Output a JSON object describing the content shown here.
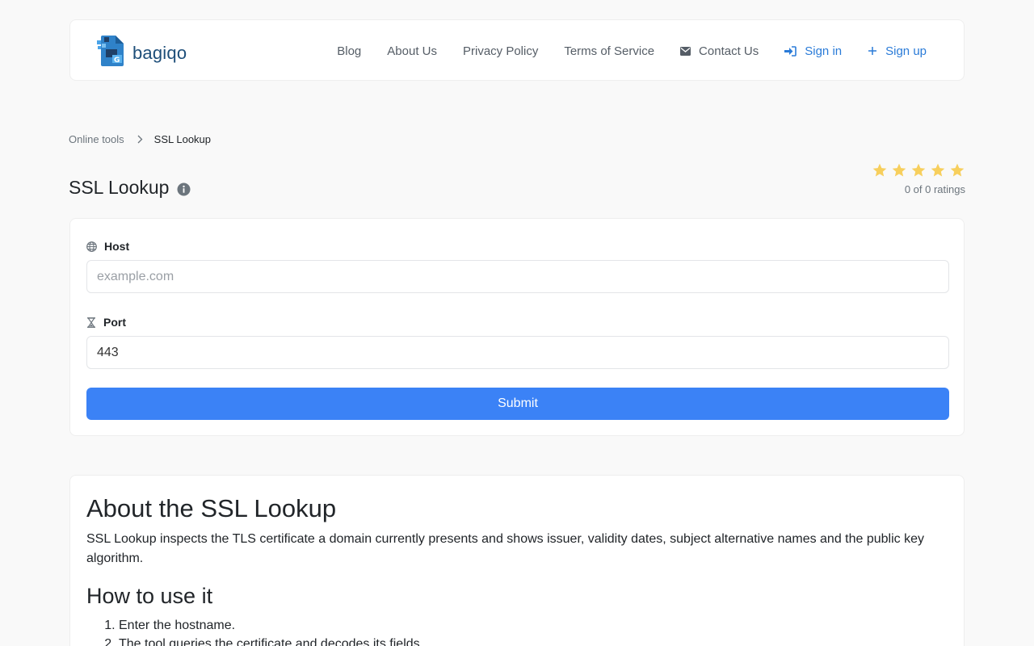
{
  "brand": {
    "name": "bagiqo"
  },
  "nav": {
    "items": [
      {
        "label": "Blog"
      },
      {
        "label": "About Us"
      },
      {
        "label": "Privacy Policy"
      },
      {
        "label": "Terms of Service"
      },
      {
        "label": "Contact Us",
        "icon": "envelope-icon"
      },
      {
        "label": "Sign in",
        "icon": "sign-in-icon"
      },
      {
        "label": "Sign up",
        "icon": "plus-icon"
      }
    ]
  },
  "breadcrumb": {
    "parent": "Online tools",
    "current": "SSL Lookup"
  },
  "page": {
    "title": "SSL Lookup"
  },
  "rating": {
    "text": "0 of 0 ratings",
    "stars": 5,
    "star_color": "#f7cf5d"
  },
  "form": {
    "host_label": "Host",
    "host_placeholder": "example.com",
    "port_label": "Port",
    "port_value": "443",
    "submit_label": "Submit",
    "submit_color": "#3b82f6"
  },
  "about": {
    "heading": "About the SSL Lookup",
    "description": "SSL Lookup inspects the TLS certificate a domain currently presents and shows issuer, validity dates, subject alternative names and the public key algorithm.",
    "howto_heading": "How to use it",
    "steps": [
      "Enter the hostname.",
      "The tool queries the certificate and decodes its fields."
    ]
  }
}
